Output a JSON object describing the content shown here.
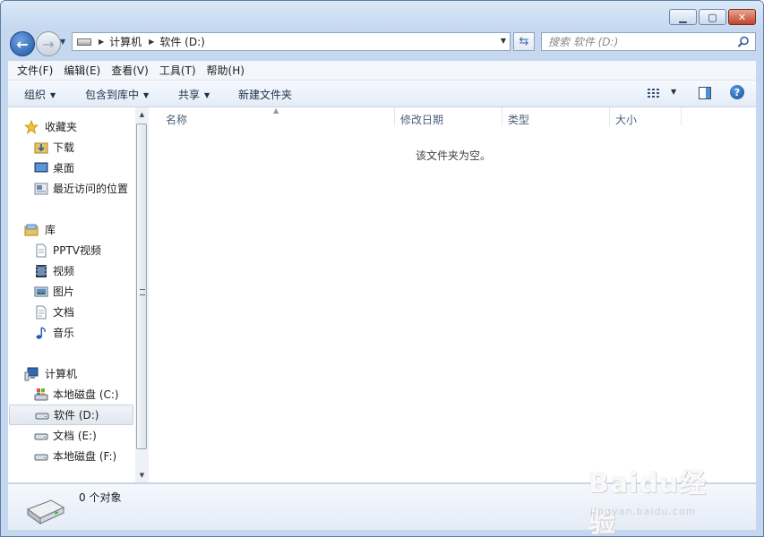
{
  "window": {
    "min_glyph": "▁",
    "max_glyph": "▢",
    "close_glyph": "✕"
  },
  "address": {
    "crumbs": [
      "计算机",
      "软件 (D:)"
    ]
  },
  "search": {
    "placeholder": "搜索 软件 (D:)"
  },
  "menu": [
    "文件(F)",
    "编辑(E)",
    "查看(V)",
    "工具(T)",
    "帮助(H)"
  ],
  "toolbar": {
    "organize": "组织",
    "include_library": "包含到库中",
    "share": "共享",
    "new_folder": "新建文件夹"
  },
  "nav": {
    "favorites": "收藏夹",
    "downloads": "下载",
    "desktop": "桌面",
    "recent": "最近访问的位置",
    "libraries": "库",
    "pptv": "PPTV视频",
    "videos": "视频",
    "pictures": "图片",
    "documents": "文档",
    "music": "音乐",
    "computer": "计算机",
    "drive_c": "本地磁盘 (C:)",
    "drive_d": "软件 (D:)",
    "drive_e": "文档 (E:)",
    "drive_f": "本地磁盘 (F:)"
  },
  "columns": {
    "name": "名称",
    "date": "修改日期",
    "type": "类型",
    "size": "大小"
  },
  "content": {
    "empty_message": "该文件夹为空。"
  },
  "details": {
    "count": "0 个对象"
  },
  "watermark": {
    "logo": "Baidu经验",
    "url": "jingyan.baidu.com"
  },
  "colors": {
    "accent": "#1d55a8",
    "close": "#c3432a",
    "pane": "#ffffff"
  }
}
